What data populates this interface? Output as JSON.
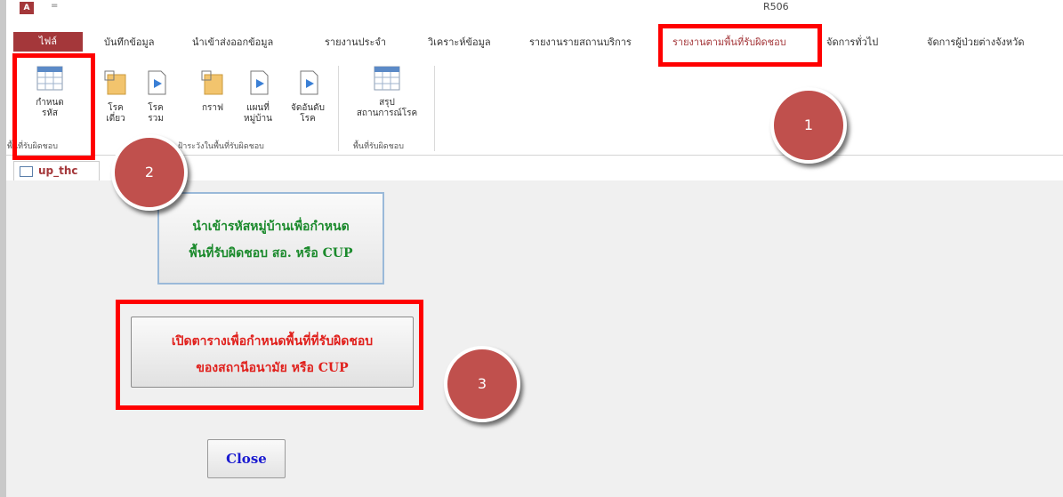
{
  "window": {
    "title": "R506",
    "app_icon": "A",
    "quick_access": "="
  },
  "ribbon_tabs": [
    {
      "label": "ไฟล์"
    },
    {
      "label": "บันทึกข้อมูล"
    },
    {
      "label": "นำเข้าส่งออกข้อมูล"
    },
    {
      "label": "รายงานประจำ"
    },
    {
      "label": "วิเคราะห์ข้อมูล"
    },
    {
      "label": "รายงานรายสถานบริการ"
    },
    {
      "label": "รายงานตามพื้นที่รับผิดชอบ"
    },
    {
      "label": "จัดการทั่วไป"
    },
    {
      "label": "จัดการผู้ป่วยต่างจังหวัด"
    }
  ],
  "ribbon": {
    "buttons": [
      {
        "line1": "กำหนด",
        "line2": "รหัส",
        "icon": "table-icon"
      },
      {
        "line1": "โรค",
        "line2": "เดี่ยว",
        "icon": "report-icon"
      },
      {
        "line1": "โรค",
        "line2": "รวม",
        "icon": "report-arrow-icon"
      },
      {
        "line1": "กราฟ",
        "line2": "",
        "icon": "report-icon"
      },
      {
        "line1": "แผนที่",
        "line2": "หมู่บ้าน",
        "icon": "report-arrow-icon"
      },
      {
        "line1": "จัดอันดับ",
        "line2": "โรค",
        "icon": "report-arrow-icon"
      },
      {
        "line1": "สรุป",
        "line2": "สถานการณ์โรค",
        "icon": "table-icon"
      }
    ],
    "groups": [
      {
        "label": "พื้นที่รับผิดชอบ"
      },
      {
        "label": "ฝ้าระวังในพื้นที่รับผิดชอบ"
      },
      {
        "label": "พื้นที่รับผิดชอบ"
      }
    ]
  },
  "object_tab": {
    "label": "up_thc"
  },
  "form": {
    "import_button": {
      "line1": "นำเข้ารหัสหมู่บ้านเพื่อกำหนด",
      "line2": "พื้นที่รับผิดชอบ สอ. หรือ CUP"
    },
    "open_table_button": {
      "line1": "เปิดตารางเพื่อกำหนดพื้นที่ที่รับผิดชอบ",
      "line2": "ของสถานีอนามัย หรือ CUP"
    },
    "close_button": {
      "label": "Close"
    }
  },
  "annotations": [
    {
      "label": "1"
    },
    {
      "label": "2"
    },
    {
      "label": "3"
    }
  ],
  "colors": {
    "access_brand": "#a4373a",
    "highlight": "#ff0000",
    "badge": "#c0504d",
    "import_text": "#1b8a2c",
    "open_text": "#e0201c",
    "close_text": "#1a1ad0"
  }
}
